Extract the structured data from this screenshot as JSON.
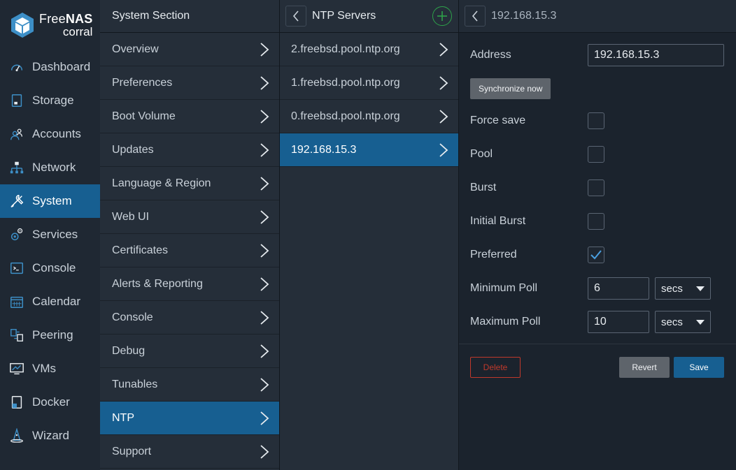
{
  "brand": {
    "name_prefix": "Free",
    "name_suffix": "NAS",
    "product": "corral"
  },
  "nav": {
    "items": [
      {
        "label": "Dashboard",
        "icon": "gauge-icon",
        "active": false
      },
      {
        "label": "Storage",
        "icon": "storage-icon",
        "active": false
      },
      {
        "label": "Accounts",
        "icon": "accounts-icon",
        "active": false
      },
      {
        "label": "Network",
        "icon": "network-icon",
        "active": false
      },
      {
        "label": "System",
        "icon": "wrench-screwdriver-icon",
        "active": true
      },
      {
        "label": "Services",
        "icon": "services-gears-icon",
        "active": false
      },
      {
        "label": "Console",
        "icon": "terminal-icon",
        "active": false
      },
      {
        "label": "Calendar",
        "icon": "calendar-icon",
        "active": false
      },
      {
        "label": "Peering",
        "icon": "peering-icon",
        "active": false
      },
      {
        "label": "VMs",
        "icon": "monitor-icon",
        "active": false
      },
      {
        "label": "Docker",
        "icon": "docker-icon",
        "active": false
      },
      {
        "label": "Wizard",
        "icon": "wizard-icon",
        "active": false
      }
    ]
  },
  "system_section": {
    "title": "System Section",
    "items": [
      {
        "label": "Overview",
        "active": false
      },
      {
        "label": "Preferences",
        "active": false
      },
      {
        "label": "Boot Volume",
        "active": false
      },
      {
        "label": "Updates",
        "active": false
      },
      {
        "label": "Language & Region",
        "active": false
      },
      {
        "label": "Web UI",
        "active": false
      },
      {
        "label": "Certificates",
        "active": false
      },
      {
        "label": "Alerts & Reporting",
        "active": false
      },
      {
        "label": "Console",
        "active": false
      },
      {
        "label": "Debug",
        "active": false
      },
      {
        "label": "Tunables",
        "active": false
      },
      {
        "label": "NTP",
        "active": true
      },
      {
        "label": "Support",
        "active": false
      }
    ]
  },
  "ntp_servers": {
    "title": "NTP Servers",
    "items": [
      {
        "label": "2.freebsd.pool.ntp.org",
        "active": false
      },
      {
        "label": "1.freebsd.pool.ntp.org",
        "active": false
      },
      {
        "label": "0.freebsd.pool.ntp.org",
        "active": false
      },
      {
        "label": "192.168.15.3",
        "active": true
      }
    ]
  },
  "detail": {
    "title": "192.168.15.3",
    "address_label": "Address",
    "address_value": "192.168.15.3",
    "sync_button": "Synchronize now",
    "force_save_label": "Force save",
    "force_save": false,
    "pool_label": "Pool",
    "pool": false,
    "burst_label": "Burst",
    "burst": false,
    "initial_burst_label": "Initial Burst",
    "initial_burst": false,
    "preferred_label": "Preferred",
    "preferred": true,
    "min_poll_label": "Minimum Poll",
    "min_poll_value": "6",
    "min_poll_unit": "secs",
    "max_poll_label": "Maximum Poll",
    "max_poll_value": "10",
    "max_poll_unit": "secs",
    "delete_button": "Delete",
    "revert_button": "Revert",
    "save_button": "Save"
  },
  "colors": {
    "accent": "#175f91",
    "add_green": "#2ea24a",
    "delete_red": "#c0392b",
    "check_blue": "#4a9fe0"
  }
}
